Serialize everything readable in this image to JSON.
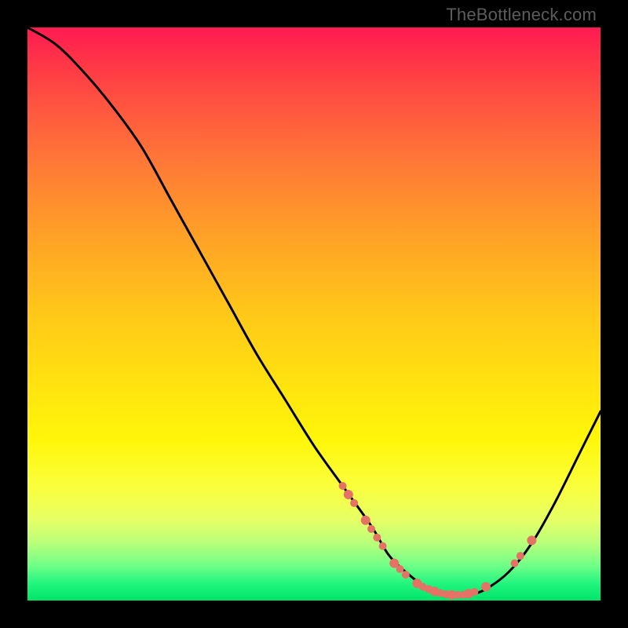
{
  "watermark": "TheBottleneck.com",
  "chart_data": {
    "type": "line",
    "title": "",
    "xlabel": "",
    "ylabel": "",
    "xlim": [
      0,
      100
    ],
    "ylim": [
      0,
      100
    ],
    "grid": false,
    "series": [
      {
        "name": "bottleneck-curve",
        "x": [
          0,
          5,
          10,
          15,
          20,
          25,
          30,
          35,
          40,
          45,
          50,
          55,
          60,
          63,
          66,
          70,
          74,
          77,
          80,
          84,
          88,
          92,
          96,
          100
        ],
        "y": [
          100,
          97,
          92,
          86,
          79,
          70,
          61,
          52,
          43,
          35,
          27,
          20,
          13,
          8,
          5,
          2,
          1,
          1,
          2,
          5,
          10,
          17,
          25,
          33
        ]
      }
    ],
    "scatter": {
      "name": "highlight-points",
      "color": "#e47265",
      "points": [
        {
          "x": 55,
          "y": 20,
          "r": 5
        },
        {
          "x": 56,
          "y": 18.5,
          "r": 6
        },
        {
          "x": 57,
          "y": 17,
          "r": 5
        },
        {
          "x": 59,
          "y": 14,
          "r": 6
        },
        {
          "x": 60,
          "y": 12.5,
          "r": 5
        },
        {
          "x": 61,
          "y": 11,
          "r": 5
        },
        {
          "x": 62,
          "y": 9.5,
          "r": 5
        },
        {
          "x": 64,
          "y": 6.5,
          "r": 6
        },
        {
          "x": 65,
          "y": 5.5,
          "r": 5
        },
        {
          "x": 66,
          "y": 4.5,
          "r": 5
        },
        {
          "x": 68,
          "y": 3,
          "r": 6
        },
        {
          "x": 69,
          "y": 2.4,
          "r": 5
        },
        {
          "x": 70,
          "y": 2,
          "r": 5
        },
        {
          "x": 71,
          "y": 1.6,
          "r": 6
        },
        {
          "x": 72,
          "y": 1.3,
          "r": 5
        },
        {
          "x": 73,
          "y": 1.1,
          "r": 5
        },
        {
          "x": 74,
          "y": 1,
          "r": 6
        },
        {
          "x": 75,
          "y": 1,
          "r": 5
        },
        {
          "x": 76,
          "y": 1,
          "r": 5
        },
        {
          "x": 77,
          "y": 1.2,
          "r": 6
        },
        {
          "x": 78,
          "y": 1.5,
          "r": 5
        },
        {
          "x": 80,
          "y": 2.4,
          "r": 6
        },
        {
          "x": 85,
          "y": 6.5,
          "r": 5
        },
        {
          "x": 86,
          "y": 7.8,
          "r": 5
        },
        {
          "x": 88,
          "y": 10.5,
          "r": 6
        }
      ]
    }
  }
}
